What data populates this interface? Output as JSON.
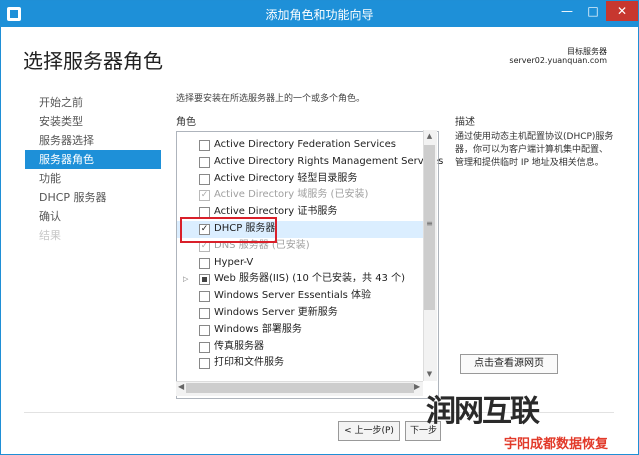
{
  "window": {
    "title": "添加角色和功能向导",
    "minimize": "—",
    "maximize": "□",
    "close": "✕"
  },
  "header": {
    "heading": "选择服务器角色",
    "target_label": "目标服务器",
    "target_server": "server02.yuanquan.com"
  },
  "nav": {
    "items": [
      {
        "label": "开始之前",
        "state": "normal"
      },
      {
        "label": "安装类型",
        "state": "normal"
      },
      {
        "label": "服务器选择",
        "state": "normal"
      },
      {
        "label": "服务器角色",
        "state": "active"
      },
      {
        "label": "功能",
        "state": "normal"
      },
      {
        "label": "DHCP 服务器",
        "state": "normal"
      },
      {
        "label": "确认",
        "state": "normal"
      },
      {
        "label": "结果",
        "state": "disabled"
      }
    ]
  },
  "content": {
    "instruction": "选择要安装在所选服务器上的一个或多个角色。",
    "roles_header": "角色",
    "description_header": "描述",
    "description": "通过使用动态主机配置协议(DHCP)服务器，你可以为客户端计算机集中配置、管理和提供临时 IP 地址及相关信息。"
  },
  "roles": [
    {
      "label": "Active Directory Federation Services",
      "checked": false,
      "disabled": false
    },
    {
      "label": "Active Directory Rights Management Services",
      "checked": false,
      "disabled": false
    },
    {
      "label": "Active Directory 轻型目录服务",
      "checked": false,
      "disabled": false
    },
    {
      "label": "Active Directory 域服务 (已安装)",
      "checked": true,
      "disabled": true
    },
    {
      "label": "Active Directory 证书服务",
      "checked": false,
      "disabled": false
    },
    {
      "label": "DHCP 服务器",
      "checked": true,
      "disabled": false,
      "selected": true
    },
    {
      "label": "DNS 服务器 (已安装)",
      "checked": true,
      "disabled": true
    },
    {
      "label": "Hyper-V",
      "checked": false,
      "disabled": false
    },
    {
      "label": "Web 服务器(IIS) (10 个已安装，共 43 个)",
      "checked": false,
      "partial": true,
      "disabled": false,
      "expandable": true
    },
    {
      "label": "Windows Server Essentials 体验",
      "checked": false,
      "disabled": false
    },
    {
      "label": "Windows Server 更新服务",
      "checked": false,
      "disabled": false
    },
    {
      "label": "Windows 部署服务",
      "checked": false,
      "disabled": false
    },
    {
      "label": "传真服务器",
      "checked": false,
      "disabled": false
    },
    {
      "label": "打印和文件服务",
      "checked": false,
      "disabled": false
    }
  ],
  "buttons": {
    "view_source": "点击查看源网页",
    "back": "< 上一步(P)",
    "next": "下一步(N) >"
  },
  "watermark": {
    "logo": "润网互联",
    "sub": "宇阳成都数据恢复"
  }
}
